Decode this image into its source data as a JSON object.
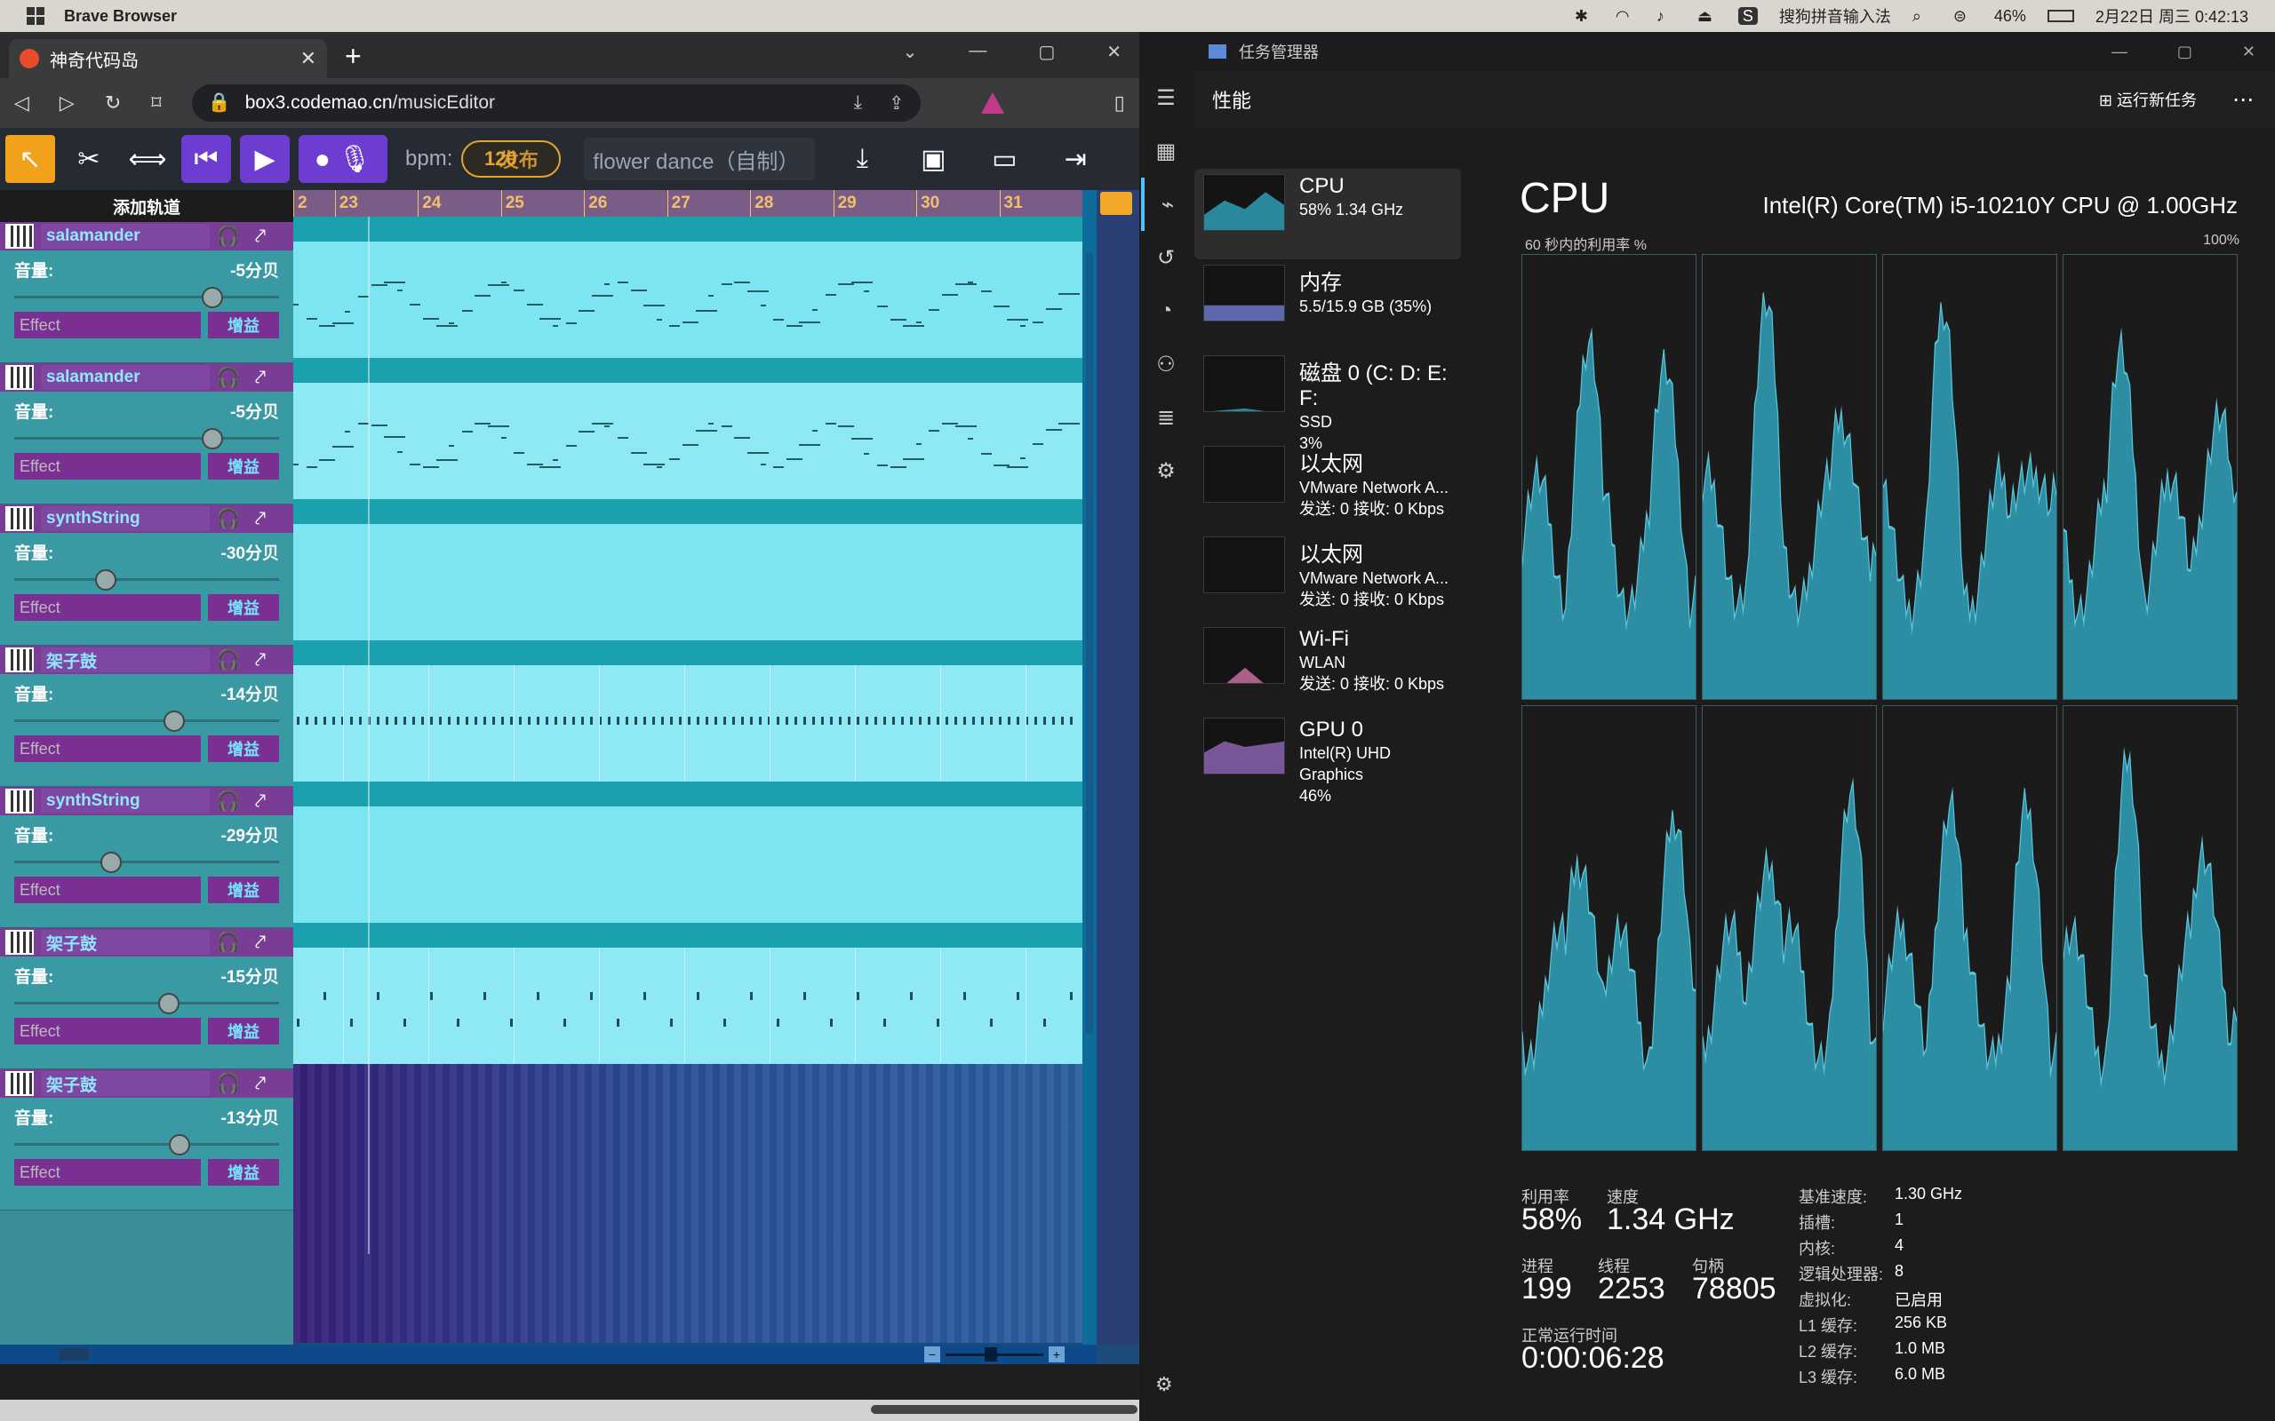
{
  "os": {
    "app": "Brave Browser",
    "ime": "搜狗拼音输入法",
    "battery": "46%",
    "datetime": "2月22日 周三 0:42:13"
  },
  "browser": {
    "tab_title": "神奇代码岛",
    "url_host": "box3.codemao.cn",
    "url_path": "/musicEditor",
    "editor": {
      "bpm_label": "bpm:",
      "bpm_value": "120",
      "bpm_overlay": "发布",
      "song": "flower dance（自制）",
      "add_track": "添加轨道",
      "volume_label": "音量:",
      "effect_label": "Effect",
      "gain_label": "增益",
      "timeline": [
        "2",
        "23",
        "24",
        "25",
        "26",
        "27",
        "28",
        "29",
        "30",
        "31"
      ],
      "tracks": [
        {
          "name": "salamander",
          "volume": "-5分贝",
          "level": 0.78
        },
        {
          "name": "salamander",
          "volume": "-5分贝",
          "level": 0.78
        },
        {
          "name": "synthString",
          "volume": "-30分贝",
          "level": 0.36
        },
        {
          "name": "架子鼓",
          "volume": "-14分贝",
          "level": 0.63
        },
        {
          "name": "synthString",
          "volume": "-29分贝",
          "level": 0.38
        },
        {
          "name": "架子鼓",
          "volume": "-15分贝",
          "level": 0.61
        },
        {
          "name": "架子鼓",
          "volume": "-13分贝",
          "level": 0.65
        }
      ]
    }
  },
  "taskmanager": {
    "title": "任务管理器",
    "section": "性能",
    "run_task": "运行新任务",
    "items": [
      {
        "title": "CPU",
        "sub1": "58% 1.34 GHz",
        "sub2": "",
        "sub3": ""
      },
      {
        "title": "内存",
        "sub1": "5.5/15.9 GB (35%)",
        "sub2": "",
        "sub3": ""
      },
      {
        "title": "磁盘 0 (C: D: E: F:",
        "sub1": "SSD",
        "sub2": "3%",
        "sub3": ""
      },
      {
        "title": "以太网",
        "sub1": "VMware Network A...",
        "sub2": "发送: 0 接收: 0 Kbps",
        "sub3": ""
      },
      {
        "title": "以太网",
        "sub1": "VMware Network A...",
        "sub2": "发送: 0 接收: 0 Kbps",
        "sub3": ""
      },
      {
        "title": "Wi-Fi",
        "sub1": "WLAN",
        "sub2": "发送: 0 接收: 0 Kbps",
        "sub3": ""
      },
      {
        "title": "GPU 0",
        "sub1": "Intel(R) UHD Graphics",
        "sub2": "46%",
        "sub3": ""
      }
    ],
    "cpu_title": "CPU",
    "cpu_name": "Intel(R) Core(TM) i5-10210Y CPU @ 1.00GHz",
    "util_caption": "60 秒内的利用率 %",
    "util_max": "100%",
    "stats": {
      "util_label": "利用率",
      "util": "58%",
      "speed_label": "速度",
      "speed": "1.34 GHz",
      "proc_label": "进程",
      "proc": "199",
      "thread_label": "线程",
      "thread": "2253",
      "handle_label": "句柄",
      "handle": "78805",
      "uptime_label": "正常运行时间",
      "uptime": "0:00:06:28"
    },
    "details": [
      {
        "k": "基准速度:",
        "v": "1.30 GHz"
      },
      {
        "k": "插槽:",
        "v": "1"
      },
      {
        "k": "内核:",
        "v": "4"
      },
      {
        "k": "逻辑处理器:",
        "v": "8"
      },
      {
        "k": "虚拟化:",
        "v": "已启用"
      },
      {
        "k": "L1 缓存:",
        "v": "256 KB"
      },
      {
        "k": "L2 缓存:",
        "v": "1.0 MB"
      },
      {
        "k": "L3 缓存:",
        "v": "6.0 MB"
      }
    ]
  }
}
